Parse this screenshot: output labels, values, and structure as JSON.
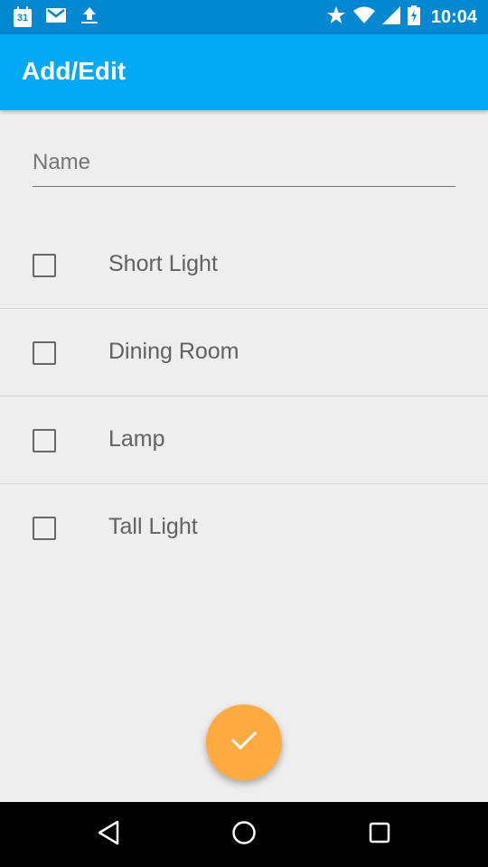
{
  "status_bar": {
    "calendar_day": "31",
    "time": "10:04",
    "left_icons": [
      "calendar-icon",
      "gmail-icon",
      "upload-icon"
    ],
    "right_icons": [
      "star-icon",
      "wifi-icon",
      "signal-icon",
      "battery-charging-icon"
    ]
  },
  "toolbar": {
    "title": "Add/Edit"
  },
  "form": {
    "name_placeholder": "Name",
    "name_value": ""
  },
  "lights": [
    {
      "label": "Short Light",
      "checked": false
    },
    {
      "label": "Dining Room",
      "checked": false
    },
    {
      "label": "Lamp",
      "checked": false
    },
    {
      "label": "Tall Light",
      "checked": false
    }
  ],
  "fab": {
    "icon": "check-icon"
  },
  "nav": {
    "icons": [
      "back-icon",
      "home-icon",
      "recents-icon"
    ]
  },
  "colors": {
    "primary": "#03a9f4",
    "primary_dark": "#0288d1",
    "accent": "#ffab40",
    "background": "#eeeeee"
  }
}
